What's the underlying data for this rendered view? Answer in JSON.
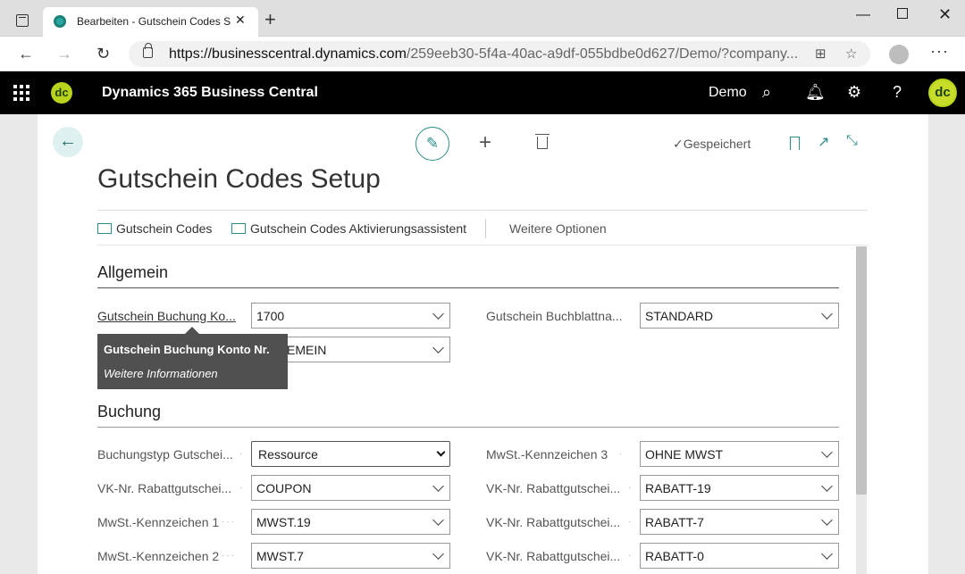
{
  "browser": {
    "tab_title": "Bearbeiten - Gutschein Codes Se",
    "url_host": "https://businesscentral.dynamics.com",
    "url_path": "/259eeb30-5f4a-40ac-a9df-055bdbe0d627/Demo/?company..."
  },
  "header": {
    "logo_text": "dc",
    "app_title": "Dynamics 365 Business Central",
    "company": "Demo",
    "avatar_text": "dc"
  },
  "page": {
    "title": "Gutschein Codes Setup",
    "saved_status": "Gespeichert",
    "actions": {
      "codes": "Gutschein Codes",
      "wizard": "Gutschein Codes Aktivierungsassistent",
      "more": "Weitere Optionen"
    }
  },
  "sections": {
    "general": {
      "title": "Allgemein",
      "fields": [
        {
          "label": "Gutschein Buchung Ko...",
          "value": "1700"
        },
        {
          "label": "",
          "value": "EMEIN"
        },
        {
          "label": "Gutschein Buchblattna...",
          "value": "STANDARD"
        }
      ]
    },
    "posting": {
      "title": "Buchung",
      "left": [
        {
          "label": "Buchungstyp Gutschei...",
          "value": "Ressource"
        },
        {
          "label": "VK-Nr. Rabattgutschei...",
          "value": "COUPON"
        },
        {
          "label": "MwSt.-Kennzeichen 1",
          "value": "MWST.19"
        },
        {
          "label": "MwSt.-Kennzeichen 2",
          "value": "MWST.7"
        }
      ],
      "right": [
        {
          "label": "MwSt.-Kennzeichen 3",
          "value": "OHNE MWST"
        },
        {
          "label": "VK-Nr. Rabattgutschei...",
          "value": "RABATT-19"
        },
        {
          "label": "VK-Nr. Rabattgutschei...",
          "value": "RABATT-7"
        },
        {
          "label": "VK-Nr. Rabattgutschei...",
          "value": "RABATT-0"
        }
      ]
    }
  },
  "tooltip": {
    "title": "Gutschein Buchung Konto Nr.",
    "link": "Weitere Informationen"
  },
  "colors": {
    "accent": "#2a8c86",
    "header_bg": "#000000",
    "logo": "#b9d21c"
  }
}
